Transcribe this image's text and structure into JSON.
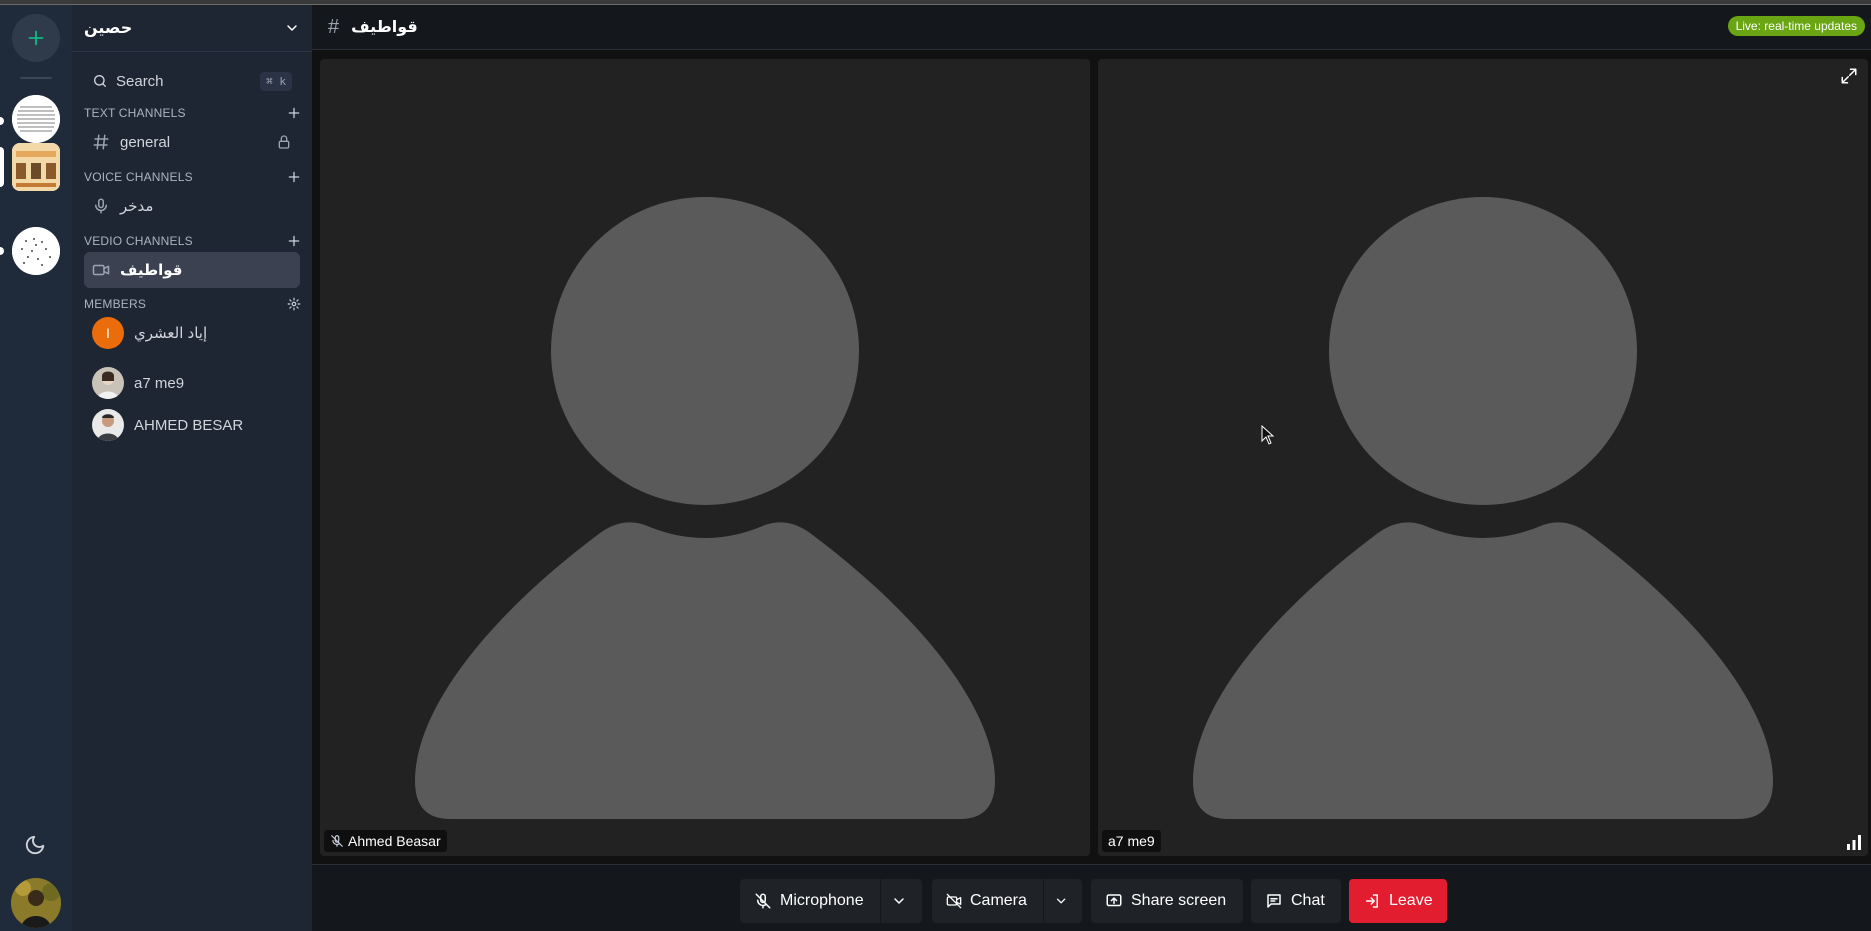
{
  "server": {
    "name": "حصين",
    "search_label": "Search",
    "search_shortcut": "⌘ k"
  },
  "sections": {
    "text": "TEXT CHANNELS",
    "voice": "VOICE CHANNELS",
    "video": "VEDIO CHANNELS",
    "members": "MEMBERS"
  },
  "channels": {
    "text": [
      {
        "label": "general",
        "icon": "hash-icon",
        "locked": true
      }
    ],
    "voice": [
      {
        "label": "مدخر",
        "icon": "microphone-icon"
      }
    ],
    "video": [
      {
        "label": "قواطيف",
        "icon": "video-camera-icon",
        "active": true
      }
    ]
  },
  "members": [
    {
      "name": "إياد العشري",
      "initial": "I",
      "avatar_color": "#ea6c0a"
    },
    {
      "name": "a7 me9",
      "avatar": "photo"
    },
    {
      "name": "AHMED BESAR",
      "avatar": "photo"
    }
  ],
  "header": {
    "title": "قواطيف",
    "live_badge": "Live: real-time updates"
  },
  "participants": [
    {
      "name": "Ahmed Beasar",
      "muted": true
    },
    {
      "name": "a7 me9",
      "muted": false
    }
  ],
  "controls": {
    "microphone": "Microphone",
    "camera": "Camera",
    "share_screen": "Share screen",
    "chat": "Chat",
    "leave": "Leave"
  },
  "colors": {
    "accent_green": "#10b981",
    "live_badge": "#6aa513",
    "leave_button": "#e11d2f",
    "sidebar": "#1e2633",
    "rail": "#1f2a3a"
  }
}
